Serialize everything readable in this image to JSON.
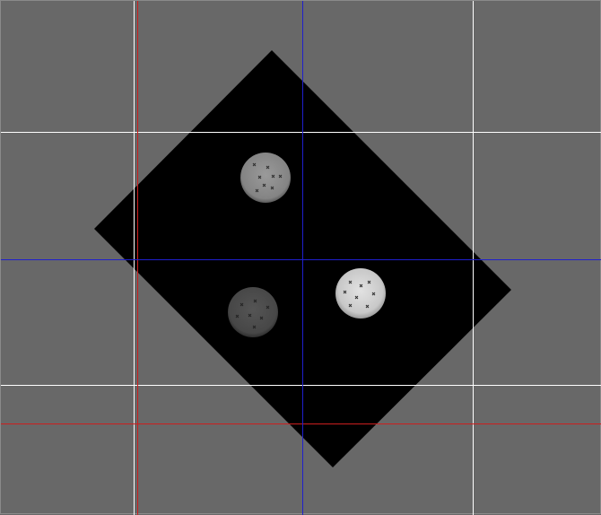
{
  "viewer": {
    "background": "#686868",
    "image_background": "#000000"
  },
  "markers": {
    "marker_glyph": "×",
    "dot_color": "#3a3a3a"
  },
  "lines": {
    "grid_color": "#ffffff",
    "crosshair_color": "#1f1fcc",
    "guide_color": "#cc1f1f"
  },
  "spots": {
    "bright_color": "#cfcfcf",
    "medium_color": "#8a8a8a",
    "dim_color": "#4a4a4a"
  }
}
